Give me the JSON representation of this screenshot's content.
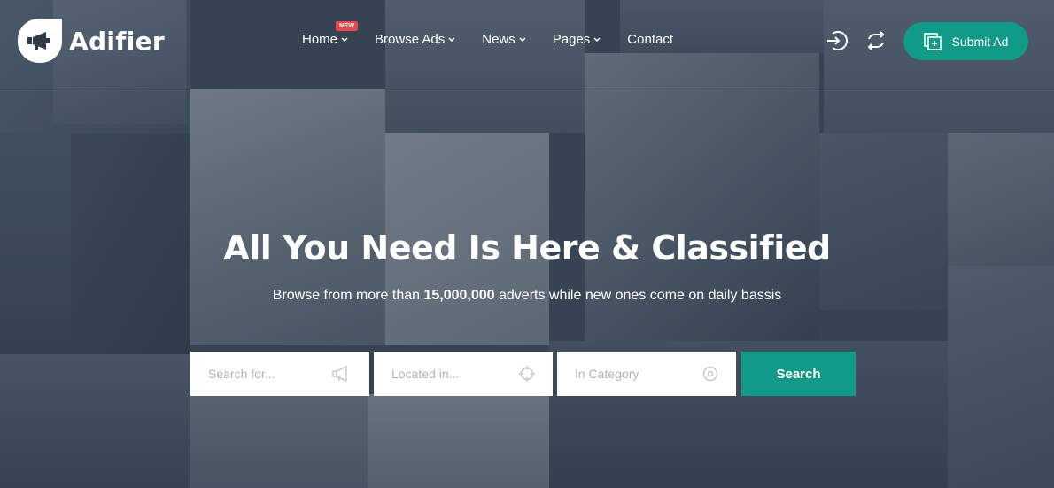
{
  "brand": {
    "name": "Adifier",
    "accent_color": "#119a87",
    "badge_color": "#e8474f"
  },
  "nav": {
    "items": [
      {
        "label": "Home",
        "badge": "NEW",
        "dropdown": true
      },
      {
        "label": "Browse Ads",
        "dropdown": true
      },
      {
        "label": "News",
        "dropdown": true
      },
      {
        "label": "Pages",
        "dropdown": true
      },
      {
        "label": "Contact",
        "dropdown": false
      }
    ]
  },
  "header_actions": {
    "login_icon": "sign-in-icon",
    "compare_icon": "refresh-icon",
    "submit_label": "Submit Ad",
    "submit_icon": "add-square-icon"
  },
  "hero": {
    "title": "All You Need Is Here & Classified",
    "subtitle_pre": "Browse from more than ",
    "subtitle_count": "15,000,000",
    "subtitle_post": " adverts while new ones come on daily bassis"
  },
  "search": {
    "keyword_placeholder": "Search for...",
    "keyword_icon": "megaphone-icon",
    "location_placeholder": "Located in...",
    "location_icon": "crosshair-icon",
    "category_placeholder": "In Category",
    "category_icon": "circle-dot-icon",
    "button_label": "Search"
  }
}
